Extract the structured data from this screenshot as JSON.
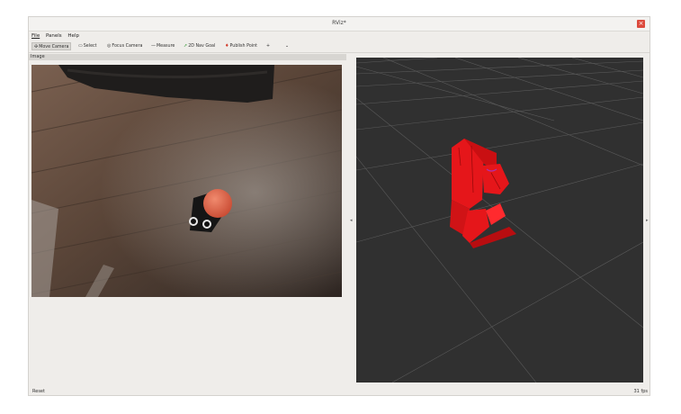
{
  "window": {
    "title": "RViz*"
  },
  "menubar": {
    "items": [
      "File",
      "Panels",
      "Help"
    ]
  },
  "toolbar": {
    "tools": [
      {
        "label": "Move Camera",
        "icon": "move-camera-icon",
        "glyph": "✣",
        "active": true
      },
      {
        "label": "Select",
        "icon": "select-icon",
        "glyph": "▭",
        "active": false
      },
      {
        "label": "Focus Camera",
        "icon": "focus-camera-icon",
        "glyph": "◎",
        "active": false
      },
      {
        "label": "Measure",
        "icon": "measure-icon",
        "glyph": "—",
        "active": false
      },
      {
        "label": "2D Nav Goal",
        "icon": "nav-goal-icon",
        "glyph": "➚",
        "active": false
      },
      {
        "label": "Publish Point",
        "icon": "publish-point-icon",
        "glyph": "♦",
        "active": false
      }
    ],
    "add_glyph": "+",
    "more_glyph": "⌄"
  },
  "image_panel": {
    "title": "Image"
  },
  "statusbar": {
    "reset_label": "Reset",
    "fps": "31 fps"
  },
  "colors": {
    "robot": "#e5161a",
    "view_background": "#303030",
    "grid": "#5a5a5a",
    "ball": "#e86a4a"
  }
}
